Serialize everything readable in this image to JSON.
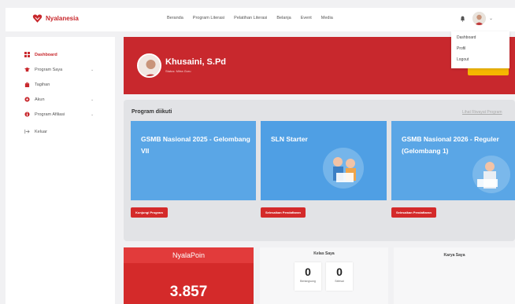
{
  "brand": {
    "name": "Nyalanesia",
    "color": "#c8282d"
  },
  "nav": [
    "Beranda",
    "Program Literasi",
    "Pelatihan Literasi",
    "Belanja",
    "Event",
    "Media"
  ],
  "user_menu": [
    "Dashboard",
    "Profil",
    "Logout"
  ],
  "sidebar": {
    "items": [
      {
        "label": "Dashboard",
        "icon": "grid-icon",
        "active": true
      },
      {
        "label": "Program Saya",
        "icon": "graduation-cap-icon",
        "has_children": true
      },
      {
        "label": "Tagihan",
        "icon": "bag-icon"
      },
      {
        "label": "Akun",
        "icon": "gear-icon",
        "has_children": true
      },
      {
        "label": "Program Afiliasi",
        "icon": "info-icon",
        "has_children": true
      },
      {
        "label": "Keluar",
        "icon": "logout-icon"
      }
    ]
  },
  "profile": {
    "name": "Khusaini, S.Pd",
    "role": "Status: Mitra Guru"
  },
  "programs": {
    "title": "Program diikuti",
    "history_link": "Lihat Riwayat Program",
    "cards": [
      {
        "title": "GSMB Nasional 2025 - Gelombang VII",
        "button": "Kunjungi Program"
      },
      {
        "title": "SLN Starter",
        "button": "Selesaikan Pendaftaran"
      },
      {
        "title": "GSMB Nasional 2026 - Reguler (Gelombang 1)",
        "button": "Selesaikan Pendaftaran"
      }
    ]
  },
  "nyalapoin": {
    "title": "NyalaPoin",
    "value": "3.857"
  },
  "kelas": {
    "title": "Kelas Saya",
    "stats": [
      {
        "value": "0",
        "label": "Berlangsung"
      },
      {
        "value": "0",
        "label": "Selesai"
      }
    ]
  },
  "karya": {
    "title": "Karya Saya"
  }
}
